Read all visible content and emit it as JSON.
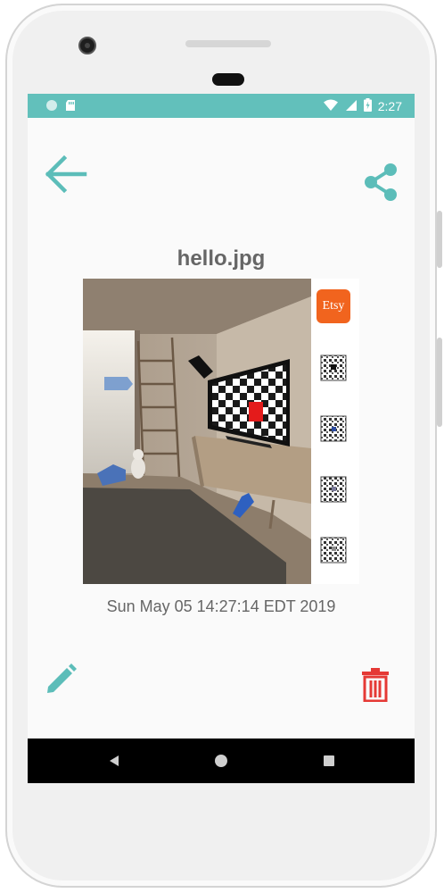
{
  "status_bar": {
    "time": "2:27",
    "background_color": "#62c0bb",
    "icons": [
      "notification-circle-icon",
      "sd-card-icon",
      "wifi-icon",
      "signal-icon",
      "battery-icon"
    ]
  },
  "toolbar": {
    "back_icon": "arrow-back-icon",
    "share_icon": "share-icon",
    "accent_color": "#5cbdb9"
  },
  "file": {
    "name": "hello.jpg",
    "date": "Sun May 05 14:27:14 EDT 2019"
  },
  "image_overlay": {
    "badge_text": "Etsy",
    "badge_color": "#f1641e"
  },
  "actions": {
    "edit_icon": "pencil-icon",
    "delete_icon": "trash-icon",
    "delete_color": "#e53935"
  },
  "nav_bar": {
    "items": [
      "back-triangle-icon",
      "home-circle-icon",
      "recents-square-icon"
    ]
  }
}
